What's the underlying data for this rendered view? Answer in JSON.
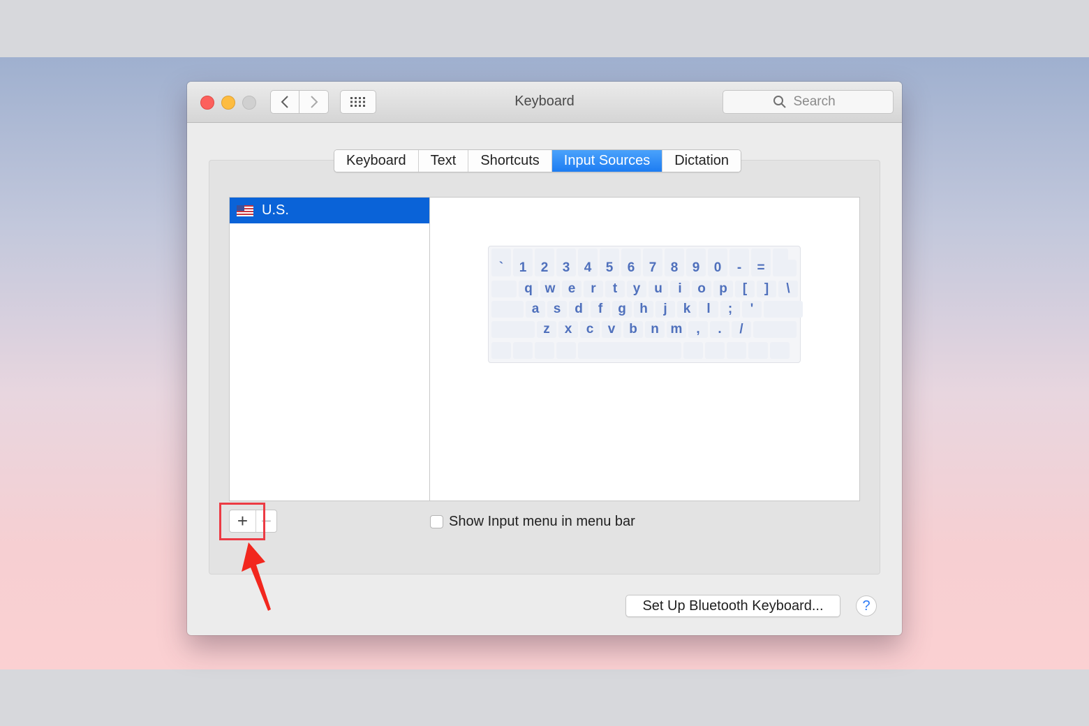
{
  "window": {
    "title": "Keyboard"
  },
  "search": {
    "placeholder": "Search"
  },
  "tabs": [
    {
      "label": "Keyboard",
      "active": false
    },
    {
      "label": "Text",
      "active": false
    },
    {
      "label": "Shortcuts",
      "active": false
    },
    {
      "label": "Input Sources",
      "active": true
    },
    {
      "label": "Dictation",
      "active": false
    }
  ],
  "input_sources": [
    {
      "label": "U.S.",
      "icon": "us-flag-icon",
      "selected": true
    }
  ],
  "keyboard_preview": {
    "rows": [
      [
        "`",
        "1",
        "2",
        "3",
        "4",
        "5",
        "6",
        "7",
        "8",
        "9",
        "0",
        "-",
        "="
      ],
      [
        "q",
        "w",
        "e",
        "r",
        "t",
        "y",
        "u",
        "i",
        "o",
        "p",
        "[",
        "]",
        "\\"
      ],
      [
        "a",
        "s",
        "d",
        "f",
        "g",
        "h",
        "j",
        "k",
        "l",
        ";",
        "'"
      ],
      [
        "z",
        "x",
        "c",
        "v",
        "b",
        "n",
        "m",
        ",",
        ".",
        "/"
      ]
    ]
  },
  "controls": {
    "add_label": "+",
    "remove_label": "−"
  },
  "show_input_menu": {
    "label": "Show Input menu in menu bar",
    "checked": false
  },
  "bluetooth_button": {
    "label": "Set Up Bluetooth Keyboard..."
  },
  "help": {
    "label": "?"
  },
  "colors": {
    "accent": "#1d7cf2",
    "selection": "#0a63d8",
    "annotation": "#ec3b44",
    "key_text": "#4f70bc"
  }
}
